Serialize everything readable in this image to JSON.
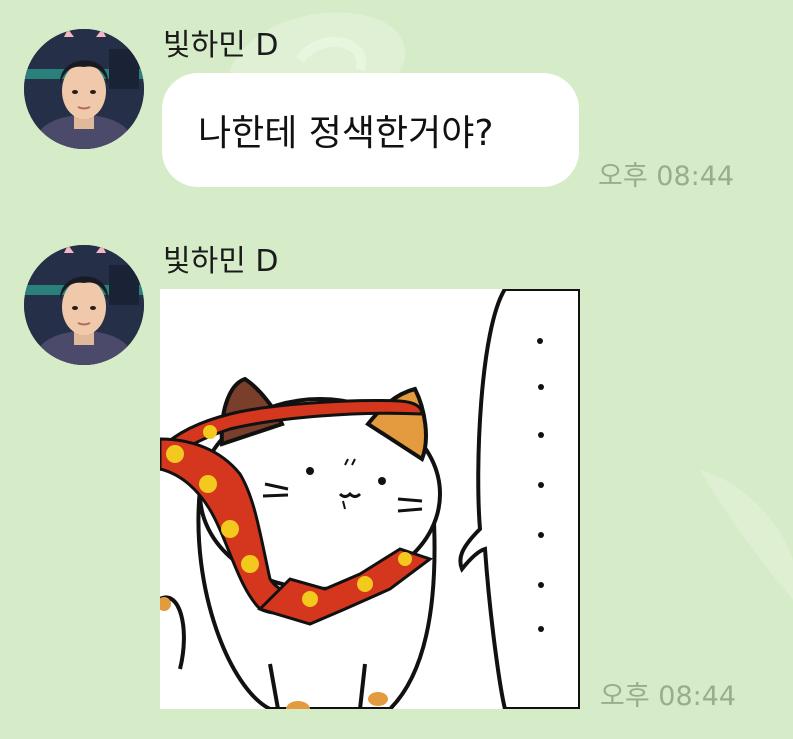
{
  "messages": [
    {
      "sender": "빛하민 D",
      "text": "나한테 정색한거야?",
      "time": "오후 08:44",
      "avatar_icon": "profile-avatar-icon"
    },
    {
      "sender": "빛하민 D",
      "sticker_icon": "cat-sticker-icon",
      "sticker_text": "·······",
      "time": "오후 08:44",
      "avatar_icon": "profile-avatar-icon"
    }
  ],
  "colors": {
    "chat_background": "#d6ecc8",
    "bubble": "#ffffff",
    "timestamp": "#98ad8c"
  }
}
